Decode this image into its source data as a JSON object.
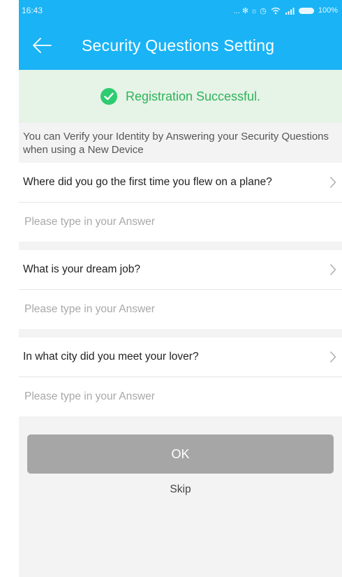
{
  "status_bar": {
    "time": "16:43",
    "icons_text": "... ✻ ☼ ◷",
    "battery": "100%"
  },
  "header": {
    "title": "Security Questions Setting",
    "back_icon": "arrow-left-icon",
    "color": "#1ab3f5"
  },
  "banner": {
    "text": "Registration Successful.",
    "icon": "check-circle-icon",
    "text_color": "#2fb35a",
    "background": "#e6f3e7"
  },
  "info_text": "You can Verify your Identity by Answering your Security Questions when using a New Device",
  "questions": [
    {
      "question": "Where did you go the first time you flew on a plane?",
      "answer_placeholder": "Please type in your Answer"
    },
    {
      "question": "What is your dream job?",
      "answer_placeholder": "Please type in your Answer"
    },
    {
      "question": "In what city did you meet your lover?",
      "answer_placeholder": "Please type in your Answer"
    }
  ],
  "actions": {
    "ok_label": "OK",
    "skip_label": "Skip",
    "ok_color": "#a6a6a6"
  }
}
